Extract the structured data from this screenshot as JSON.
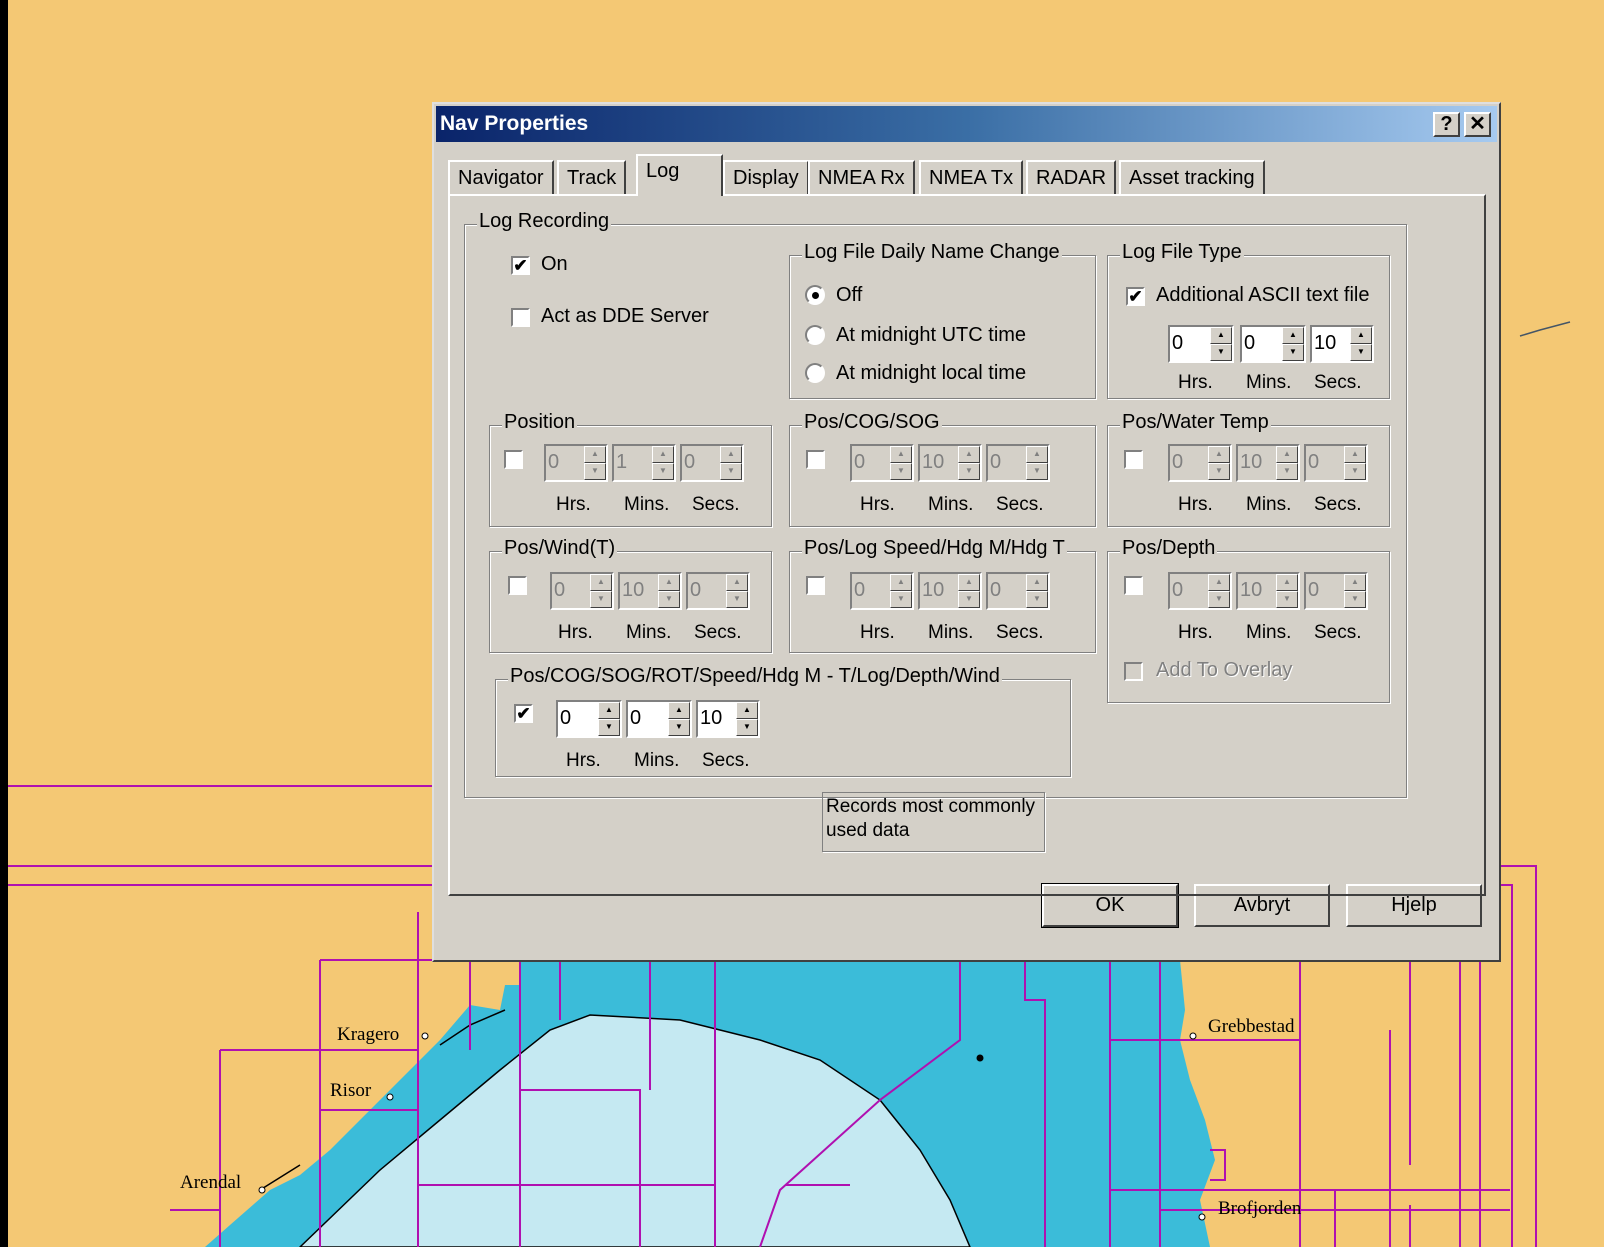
{
  "map": {
    "labels": [
      "Kragero",
      "Risor",
      "Arendal",
      "Grebbestad",
      "Brofjorden"
    ],
    "colors": {
      "land": "#f4c874",
      "shallow": "#3bbcd9",
      "deep": "#c5e9f2",
      "chart_lines": "#b010b0"
    }
  },
  "dialog": {
    "title": "Nav Properties",
    "help_btn": "?",
    "close_btn": "✕",
    "tabs": [
      "Navigator",
      "Track",
      "Log",
      "Display",
      "NMEA Rx",
      "NMEA Tx",
      "RADAR",
      "Asset tracking"
    ],
    "active_tab": "Log",
    "log_recording": {
      "label": "Log Recording",
      "on": {
        "label": "On",
        "checked": "✔"
      },
      "dde": {
        "label": "Act as DDE  Server",
        "checked": ""
      }
    },
    "daily_name": {
      "label": "Log File Daily Name Change",
      "options": [
        "Off",
        "At midnight UTC time",
        "At midnight local time"
      ],
      "selected": "Off"
    },
    "file_type": {
      "label": "Log File Type",
      "ascii": {
        "label": "Additional ASCII text file",
        "checked": "✔"
      },
      "hrs": "0",
      "mins": "0",
      "secs": "10"
    },
    "units": {
      "hrs": "Hrs.",
      "mins": "Mins.",
      "secs": "Secs."
    },
    "groups": {
      "position": {
        "label": "Position",
        "hrs": "0",
        "mins": "1",
        "secs": "0"
      },
      "pos_cog_sog": {
        "label": "Pos/COG/SOG",
        "hrs": "0",
        "mins": "10",
        "secs": "0"
      },
      "pos_water_temp": {
        "label": "Pos/Water Temp",
        "hrs": "0",
        "mins": "10",
        "secs": "0"
      },
      "pos_wind": {
        "label": "Pos/Wind(T)",
        "hrs": "0",
        "mins": "10",
        "secs": "0"
      },
      "pos_log_speed": {
        "label": "Pos/Log Speed/Hdg M/Hdg T",
        "hrs": "0",
        "mins": "10",
        "secs": "0"
      },
      "pos_depth": {
        "label": "Pos/Depth",
        "hrs": "0",
        "mins": "10",
        "secs": "0",
        "add_overlay": "Add To Overlay"
      },
      "combined": {
        "label": "Pos/COG/SOG/ROT/Speed/Hdg M - T/Log/Depth/Wind",
        "checked": "✔",
        "hrs": "0",
        "mins": "0",
        "secs": "10",
        "note": "Records  most commonly used data"
      }
    },
    "buttons": {
      "ok": "OK",
      "cancel": "Avbryt",
      "help": "Hjelp"
    }
  }
}
